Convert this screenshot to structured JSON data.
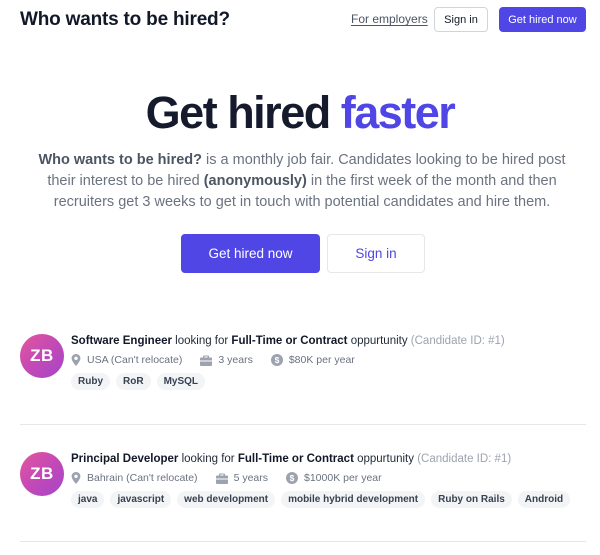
{
  "header": {
    "title": "Who wants to be hired?",
    "for_employers": "For employers",
    "sign_in": "Sign in",
    "get_hired_now": "Get hired now"
  },
  "hero": {
    "title_main": "Get hired",
    "title_accent": "faster",
    "desc_bold1": "Who wants to be hired?",
    "desc_part1": " is a monthly job fair. Candidates looking to be hired post their interest to be hired ",
    "desc_bold2": "(anonymously)",
    "desc_part2": " in the first week of the month and then recruiters get 3 weeks to get in touch with potential candidates and hire them.",
    "cta_primary": "Get hired now",
    "cta_secondary": "Sign in"
  },
  "candidates": [
    {
      "initials": "ZB",
      "role": "Software Engineer",
      "looking_text": " looking for ",
      "contract": "Full-Time or Contract",
      "opportunity": " oppurtunity ",
      "candidate_id": "(Candidate ID: #1)",
      "location": "USA (Can't relocate)",
      "experience": "3 years",
      "salary": "$80K per year",
      "tags": [
        "Ruby",
        "RoR",
        "MySQL"
      ]
    },
    {
      "initials": "ZB",
      "role": "Principal Developer",
      "looking_text": " looking for ",
      "contract": "Full-Time or Contract",
      "opportunity": " oppurtunity ",
      "candidate_id": "(Candidate ID: #1)",
      "location": "Bahrain (Can't relocate)",
      "experience": "5 years",
      "salary": "$1000K per year",
      "tags": [
        "java",
        "javascript",
        "web development",
        "mobile hybrid development",
        "Ruby on Rails",
        "Android"
      ]
    }
  ],
  "icons": {
    "location": "map-pin-icon",
    "experience": "briefcase-icon",
    "salary": "dollar-circle-icon"
  },
  "colors": {
    "accent": "#4f46e5",
    "avatar_gradient_start": "#e4569b",
    "avatar_gradient_end": "#a546c9"
  }
}
